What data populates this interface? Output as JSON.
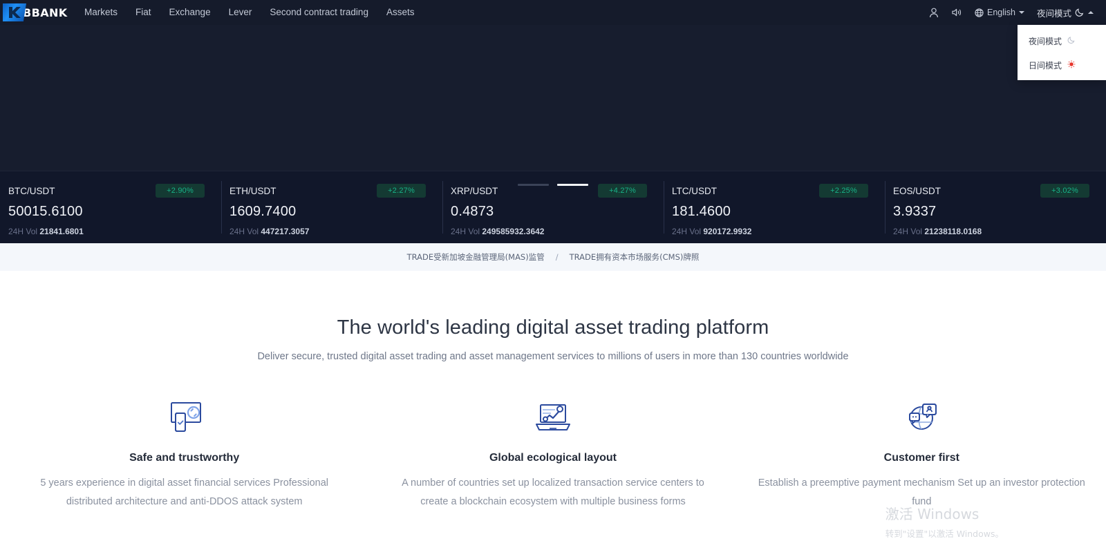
{
  "header": {
    "logo_text": "BBANK",
    "logo_icon": "k-logo-icon",
    "nav": [
      {
        "label": "Markets"
      },
      {
        "label": "Fiat"
      },
      {
        "label": "Exchange"
      },
      {
        "label": "Lever"
      },
      {
        "label": "Second contract trading"
      },
      {
        "label": "Assets"
      }
    ],
    "right": {
      "user_icon": "user-icon",
      "sound_icon": "speaker-icon",
      "globe_icon": "globe-icon",
      "language": "English",
      "theme_label": "夜间模式",
      "theme_icon": "moon-icon"
    },
    "mode_dropdown": {
      "items": [
        {
          "label": "夜间模式",
          "icon": "moon-icon",
          "glyph": "☽"
        },
        {
          "label": "日间模式",
          "icon": "sun-icon",
          "glyph": "☀"
        }
      ]
    }
  },
  "hero": {
    "slides": [
      {
        "active": false
      },
      {
        "active": true
      }
    ]
  },
  "ticker": {
    "vol_label": "24H Vol",
    "items": [
      {
        "pair": "BTC/USDT",
        "change": "+2.90%",
        "price": "50015.6100",
        "volume": "21841.6801"
      },
      {
        "pair": "ETH/USDT",
        "change": "+2.27%",
        "price": "1609.7400",
        "volume": "447217.3057"
      },
      {
        "pair": "XRP/USDT",
        "change": "+4.27%",
        "price": "0.4873",
        "volume": "249585932.3642"
      },
      {
        "pair": "LTC/USDT",
        "change": "+2.25%",
        "price": "181.4600",
        "volume": "920172.9932"
      },
      {
        "pair": "EOS/USDT",
        "change": "+3.02%",
        "price": "3.9337",
        "volume": "21238118.0168"
      }
    ]
  },
  "regbar": {
    "left": "TRADE受新加坡金融管理局(MAS)监管",
    "separator": "/",
    "right": "TRADE拥有资本市场服务(CMS)牌照"
  },
  "main": {
    "title": "The world's leading digital asset trading platform",
    "subtitle": "Deliver secure, trusted digital asset trading and asset management services to millions of users in more than 130 countries worldwide",
    "features": [
      {
        "icon": "monitor-sync-phone-icon",
        "title": "Safe and trustworthy",
        "desc": "5 years experience in digital asset financial services Professional distributed architecture and anti-DDOS attack system"
      },
      {
        "icon": "laptop-chart-icon",
        "title": "Global ecological layout",
        "desc": "A number of countries set up localized transaction service centers to create a blockchain ecosystem with multiple business forms"
      },
      {
        "icon": "globe-chat-icon",
        "title": "Customer first",
        "desc": "Establish a preemptive payment mechanism Set up an investor protection fund"
      }
    ]
  },
  "watermark": {
    "title": "激活 Windows",
    "subtitle": "转到\"设置\"以激活 Windows。"
  },
  "colors": {
    "header_bg": "#151b2b",
    "hero_bg": "#171d2e",
    "ticker_bg": "#11172a",
    "positive": "#18b388",
    "badge_bg": "#143a33",
    "accent_blue": "#1f8ff5",
    "icon_blue": "#2b4a9e",
    "regbar_bg": "#f4f7fb"
  }
}
